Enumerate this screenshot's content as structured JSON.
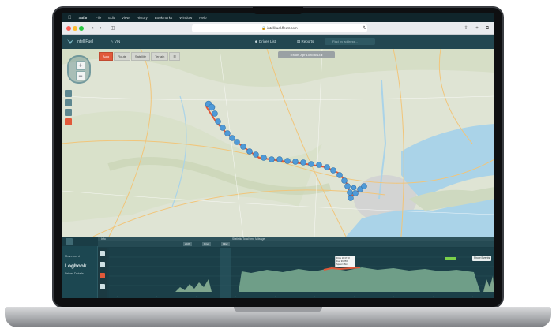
{
  "menubar": {
    "app": "Safari",
    "items": [
      "File",
      "Edit",
      "View",
      "History",
      "Bookmarks",
      "Window",
      "Help"
    ]
  },
  "browser": {
    "url": "intellifuel.fleetr.com",
    "dot_colors": [
      "#ff5f57",
      "#febc2e",
      "#28c840"
    ]
  },
  "app": {
    "brand": "intelliFuel",
    "vehicle_short": "VIN",
    "header_right": [
      "Drives List",
      "Reports"
    ],
    "search_placeholder": "Find by address..."
  },
  "map": {
    "layer_tabs": [
      "Auto",
      "Route",
      "Satellite",
      "Terrain"
    ],
    "active_tab": "Auto",
    "date_range": "Mon, Apr 10 to 8/13",
    "route_color": "#4f9ad8",
    "accent": "#e1593a"
  },
  "panel": {
    "strip_label": "Info",
    "strip_center": "Statistic   Total time   Mileage",
    "chips": [
      "2026",
      "Drive",
      "Filter"
    ],
    "vehicle_label": "Movement",
    "vehicle_name": "Logbook",
    "vehicle_sub": "Driver Details",
    "show_btn": "Show Events",
    "tooltip": [
      "Drive 18:37:22",
      "Fuel 99.85%",
      "Speed 48km"
    ]
  }
}
